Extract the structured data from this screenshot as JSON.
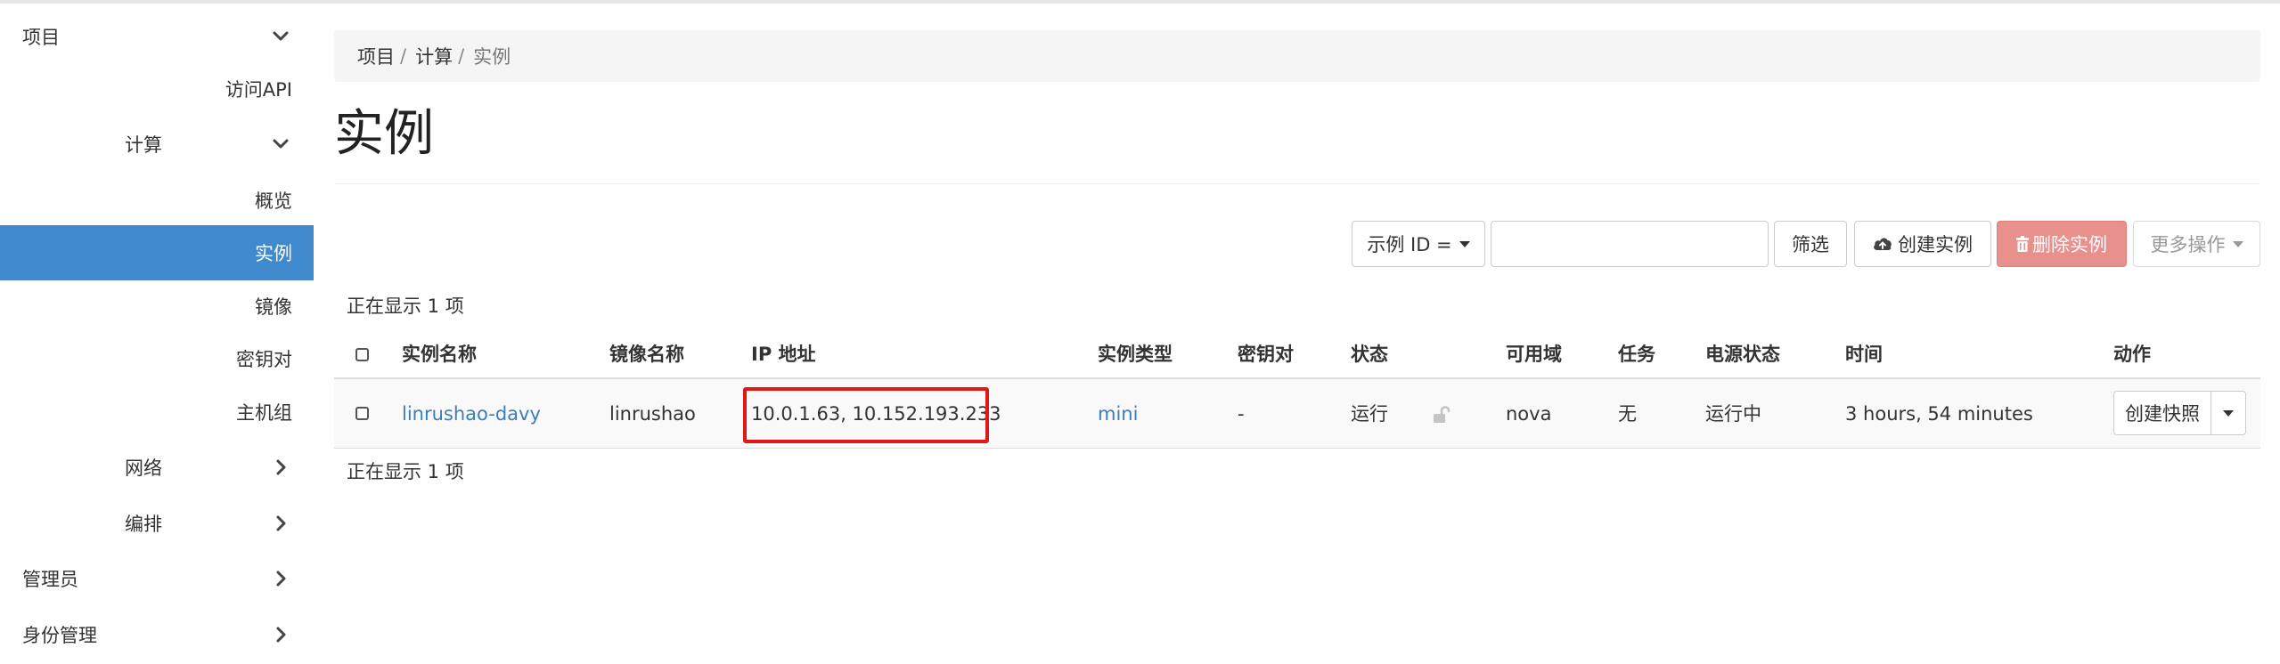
{
  "sidebar": {
    "project": "项目",
    "api_access": "访问API",
    "compute": "计算",
    "overview": "概览",
    "instances": "实例",
    "images": "镜像",
    "key_pairs": "密钥对",
    "server_groups": "主机组",
    "network": "网络",
    "orchestration": "编排",
    "admin": "管理员",
    "identity": "身份管理"
  },
  "breadcrumb": [
    "项目",
    "计算",
    "实例"
  ],
  "page_title": "实例",
  "toolbar": {
    "filter_field": "示例 ID =",
    "filter_value": "",
    "filter_button": "筛选",
    "create_button": "创建实例",
    "delete_button": "删除实例",
    "more_button": "更多操作"
  },
  "count_text": "正在显示 1 项",
  "table": {
    "headers": {
      "name": "实例名称",
      "image": "镜像名称",
      "ip": "IP 地址",
      "flavor": "实例类型",
      "keypair": "密钥对",
      "status": "状态",
      "az": "可用域",
      "task": "任务",
      "power": "电源状态",
      "time": "时间",
      "actions": "动作"
    },
    "rows": [
      {
        "name": "linrushao-davy",
        "image": "linrushao",
        "ip": "10.0.1.63, 10.152.193.233",
        "flavor": "mini",
        "keypair": "-",
        "status": "运行",
        "az": "nova",
        "task": "无",
        "power": "运行中",
        "time": "3 hours, 54 minutes",
        "action": "创建快照"
      }
    ]
  },
  "colors": {
    "active_nav": "#3f89cc",
    "link": "#3a7ebf",
    "danger": "#e8908c",
    "highlight": "#e01818"
  },
  "icons": [
    "chevron-down-icon",
    "chevron-right-icon",
    "cloud-upload-icon",
    "trash-icon",
    "lock-icon",
    "caret-down-icon"
  ]
}
